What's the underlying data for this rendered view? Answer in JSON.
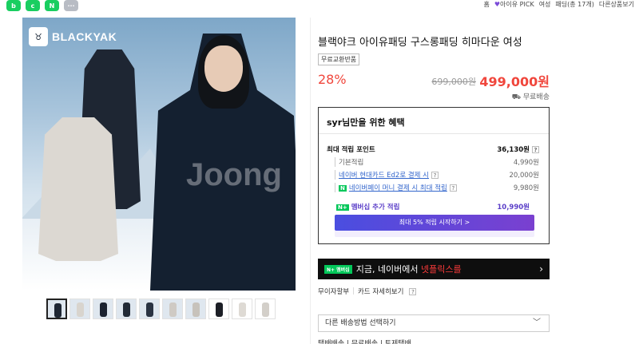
{
  "topbar": {
    "app_icons": [
      {
        "label": "b",
        "color": "green",
        "icon": "blog-icon"
      },
      {
        "label": "c",
        "color": "green",
        "icon": "cafe-icon"
      },
      {
        "label": "N",
        "color": "green",
        "icon": "naver-icon"
      },
      {
        "label": "···",
        "color": "gray",
        "icon": "more-icon"
      }
    ],
    "links": [
      "홈",
      "아이유 PICK",
      "여성",
      "패딩(총 17개)",
      "다른상품보기"
    ]
  },
  "gallery": {
    "brand_logo_text": "BLACKYAK",
    "watermark": "Joong",
    "thumbnails_count": 10
  },
  "product": {
    "title": "블랙야크 아이유패딩 구스롱패딩 히마다운 여성",
    "badge": "무료교환반품",
    "discount": "28%",
    "original_price": "699,000원",
    "sale_price": "499,000원",
    "shipping": "무료배송"
  },
  "benefits": {
    "title": "syr님만을 위한 혜택",
    "max_points_label": "최대 적립 포인트",
    "max_points_value": "36,130원",
    "rows": [
      {
        "label": "기본적립",
        "value": "4,990원"
      },
      {
        "label": "네이버 현대카드 Ed2로 결제 시",
        "value": "20,000원"
      },
      {
        "label": "네이버페이 머니 결제 시 최대 적립",
        "value": "9,980원"
      }
    ],
    "member_label": "멤버십 추가 적립",
    "member_value": "10,990원",
    "member_button": "최대 5% 적립 시작하기 >"
  },
  "banner": {
    "tag": "N+ 멤버십",
    "text_prefix": "지금, ",
    "text_mid": "네이버에서 ",
    "text_hl": "넷플릭스를",
    "arrow": "›"
  },
  "links_row": {
    "installment": "무이자할부",
    "card_detail": "카드 자세히보기"
  },
  "shipping_select": {
    "placeholder": "다른 배송방법 선택하기"
  },
  "shipping_tabs": "택배배송 | 무료배송 | 토제택배"
}
